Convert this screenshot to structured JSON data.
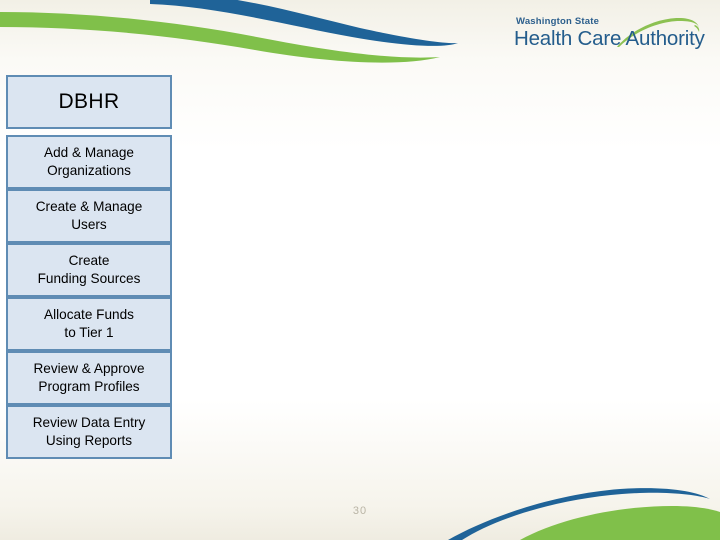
{
  "slide": {
    "page_number": "30",
    "background_color": "#ffffff",
    "band_color": "#f0ede3"
  },
  "logo": {
    "name": "washington-state-health-care-authority-logo",
    "line1": "Washington State",
    "line2": "Health Care Authority",
    "text_color": "#245d8c",
    "swoosh_color": "#8cc152"
  },
  "decoration": {
    "wave_green": "#80c04a",
    "wave_blue": "#1f6398"
  },
  "diagram": {
    "title_box": {
      "label": "DBHR"
    },
    "box_fill": "#dbe5f1",
    "box_border": "#5f8cb4",
    "steps": [
      {
        "line1": "Add & Manage",
        "line2": "Organizations"
      },
      {
        "line1": "Create & Manage",
        "line2": "Users"
      },
      {
        "line1": "Create",
        "line2": "Funding Sources"
      },
      {
        "line1": "Allocate Funds",
        "line2": "to Tier 1"
      },
      {
        "line1": "Review & Approve",
        "line2": "Program Profiles"
      },
      {
        "line1": "Review Data Entry",
        "line2": "Using Reports"
      }
    ]
  }
}
